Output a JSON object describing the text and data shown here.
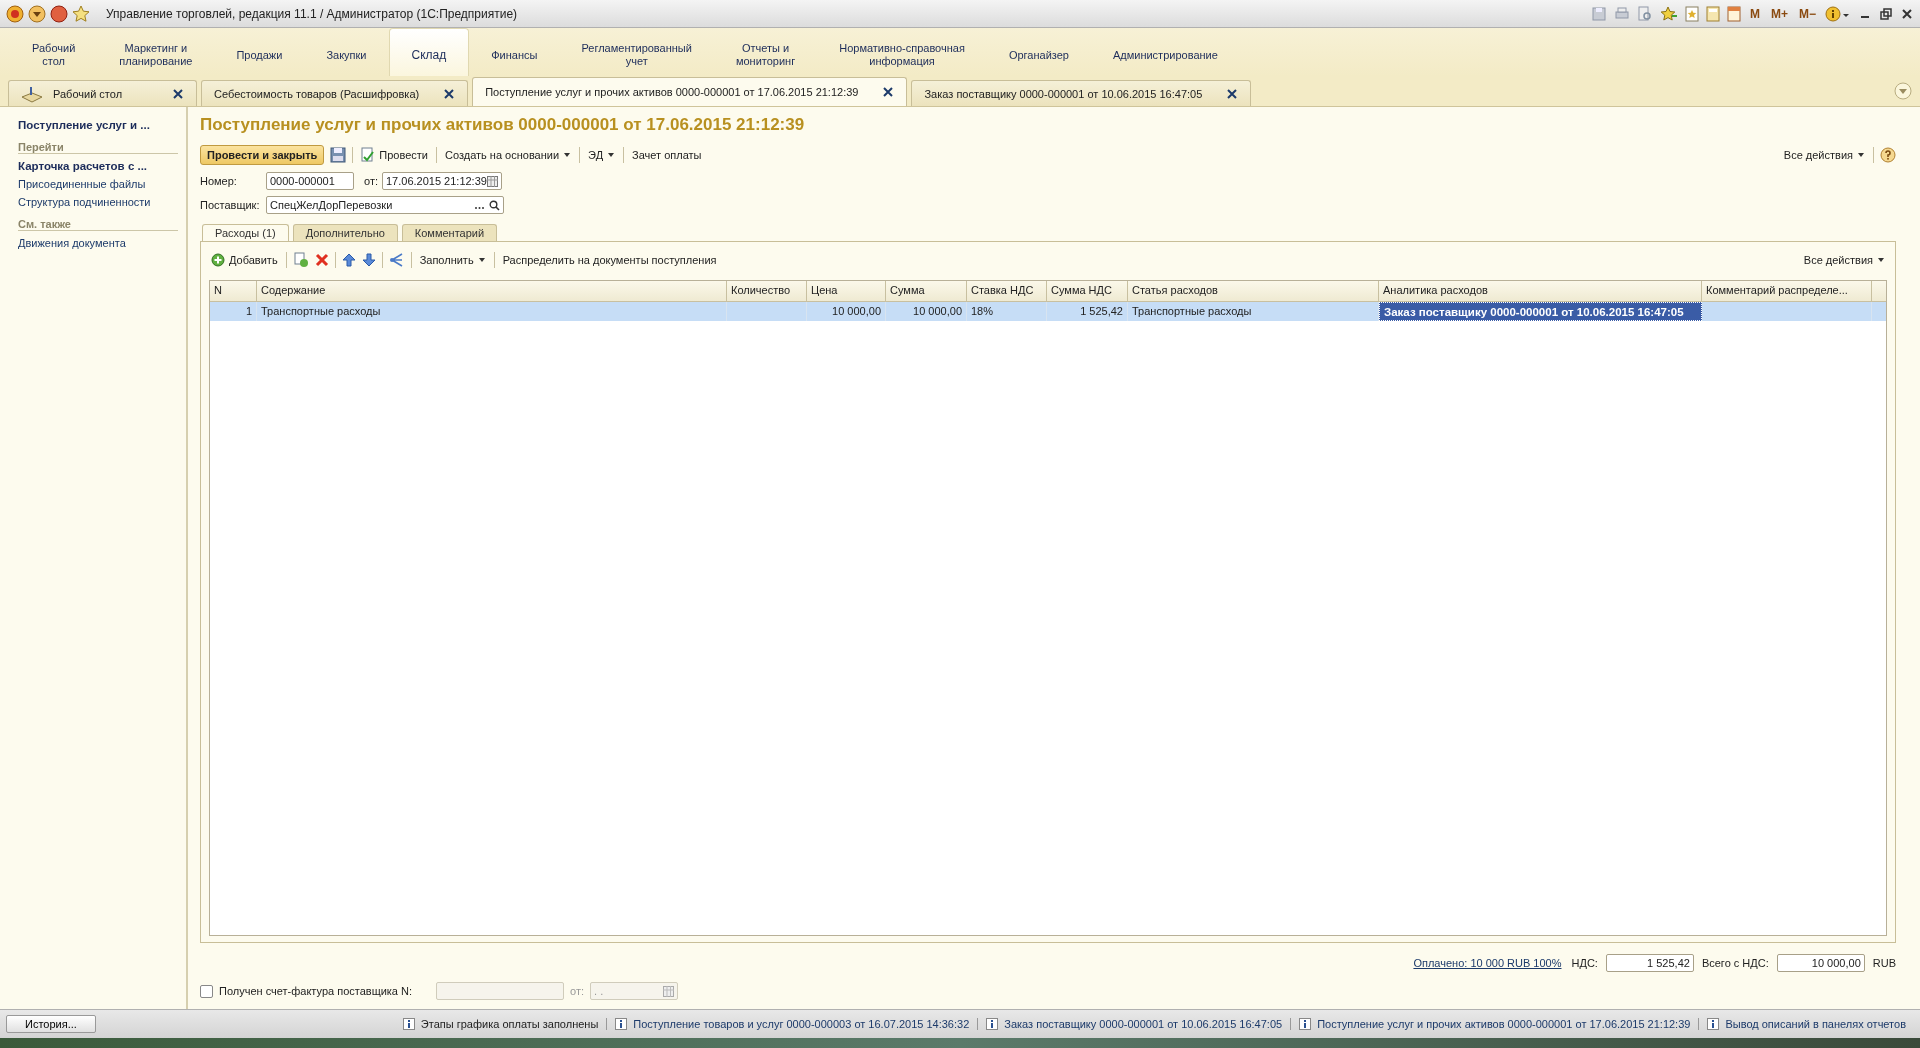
{
  "window": {
    "title": "Управление торговлей, редакция 11.1 / Администратор  (1С:Предприятие)",
    "memory_keys": [
      "M",
      "M+",
      "M−"
    ]
  },
  "sections": [
    {
      "label": "Рабочий\nстол",
      "selected": false
    },
    {
      "label": "Маркетинг и\nпланирование",
      "selected": false
    },
    {
      "label": "Продажи",
      "selected": false
    },
    {
      "label": "Закупки",
      "selected": false
    },
    {
      "label": "Склад",
      "selected": true
    },
    {
      "label": "Финансы",
      "selected": false
    },
    {
      "label": "Регламентированный\nучет",
      "selected": false
    },
    {
      "label": "Отчеты и\nмониторинг",
      "selected": false
    },
    {
      "label": "Нормативно-справочная\nинформация",
      "selected": false
    },
    {
      "label": "Органайзер",
      "selected": false
    },
    {
      "label": "Администрирование",
      "selected": false
    }
  ],
  "open_tabs": [
    {
      "label": "Рабочий стол",
      "kind": "home",
      "selected": false
    },
    {
      "label": "Себестоимость товаров (Расшифровка)",
      "kind": "doc",
      "selected": false
    },
    {
      "label": "Поступление услуг и прочих активов 0000-000001 от 17.06.2015 21:12:39",
      "kind": "doc",
      "selected": true
    },
    {
      "label": "Заказ поставщику 0000-000001 от 10.06.2015 16:47:05",
      "kind": "doc",
      "selected": false
    }
  ],
  "nav": [
    {
      "label": "Поступление услуг и ...",
      "kind": "current"
    },
    {
      "label": "Перейти",
      "kind": "heading"
    },
    {
      "label": "Карточка расчетов с ...",
      "kind": "strong"
    },
    {
      "label": "Присоединенные файлы",
      "kind": "link"
    },
    {
      "label": "Структура подчиненности",
      "kind": "link"
    },
    {
      "label": "См. также",
      "kind": "heading"
    },
    {
      "label": "Движения документа",
      "kind": "link"
    }
  ],
  "form": {
    "title": "Поступление услуг и прочих активов 0000-000001 от 17.06.2015 21:12:39",
    "commands": [
      {
        "label": "Провести и закрыть",
        "kind": "primary"
      },
      {
        "kind": "save"
      },
      {
        "label": "Провести",
        "kind": "post"
      },
      {
        "label": "Создать на основании",
        "kind": "dropdown"
      },
      {
        "label": "ЭД",
        "kind": "dropdown"
      },
      {
        "label": "Зачет оплаты",
        "kind": "plain"
      }
    ],
    "all_actions": "Все действия",
    "number_label": "Номер:",
    "number": "0000-000001",
    "date_label": "от:",
    "date": "17.06.2015 21:12:39",
    "supplier_label": "Поставщик:",
    "supplier": "СпецЖелДорПеревозки",
    "tabs": [
      {
        "label": "Расходы (1)",
        "selected": true
      },
      {
        "label": "Дополнительно",
        "selected": false
      },
      {
        "label": "Комментарий",
        "selected": false
      }
    ],
    "table_commands": [
      {
        "label": "Добавить",
        "kind": "add"
      },
      {
        "kind": "copy"
      },
      {
        "kind": "delete"
      },
      {
        "kind": "up"
      },
      {
        "kind": "down"
      },
      {
        "kind": "tree"
      },
      {
        "label": "Заполнить",
        "kind": "dropdown"
      },
      {
        "label": "Распределить на документы поступления",
        "kind": "plain"
      }
    ],
    "table_all_actions": "Все действия",
    "table": {
      "columns": [
        {
          "label": "N",
          "kind": "number"
        },
        {
          "label": "Содержание",
          "kind": "text"
        },
        {
          "label": "Количество",
          "kind": "number"
        },
        {
          "label": "Цена",
          "kind": "number"
        },
        {
          "label": "Сумма",
          "kind": "number"
        },
        {
          "label": "Ставка НДС",
          "kind": "text"
        },
        {
          "label": "Сумма НДС",
          "kind": "number"
        },
        {
          "label": "Статья расходов",
          "kind": "text"
        },
        {
          "label": "Аналитика расходов",
          "kind": "text"
        },
        {
          "label": "Комментарий распределе...",
          "kind": "text"
        }
      ],
      "rows": [
        {
          "selected": true,
          "cells": [
            {
              "value": "1",
              "current": false
            },
            {
              "value": "Транспортные расходы",
              "current": false
            },
            {
              "current": false
            },
            {
              "value": "10 000,00",
              "current": false
            },
            {
              "value": "10 000,00",
              "current": false
            },
            {
              "value": "18%",
              "current": false
            },
            {
              "value": "1 525,42",
              "current": false
            },
            {
              "value": "Транспортные расходы",
              "current": false
            },
            {
              "value": "Заказ поставщику 0000-000001 от 10.06.2015 16:47:05",
              "current": true
            },
            {
              "current": false
            }
          ]
        }
      ]
    },
    "paid_link": "Оплачено: 10 000 RUB  100%",
    "vat_label": "НДС:",
    "vat": "1 525,42",
    "total_label": "Всего с НДС:",
    "total": "10 000,00",
    "currency": "RUB",
    "invoice": {
      "checked": false,
      "label": "Получен счет-фактура поставщика N:",
      "date_label": "от:",
      "date": ". ."
    }
  },
  "status_bar": {
    "history": "История...",
    "messages": [
      "Этапы графика оплаты заполнены",
      "Поступление товаров и услуг 0000-000003 от 16.07.2015 14:36:32",
      "Заказ поставщику 0000-000001 от 10.06.2015 16:47:05",
      "Поступление услуг и прочих активов 0000-000001 от 17.06.2015 21:12:39",
      "Вывод описаний в панелях отчетов"
    ]
  }
}
